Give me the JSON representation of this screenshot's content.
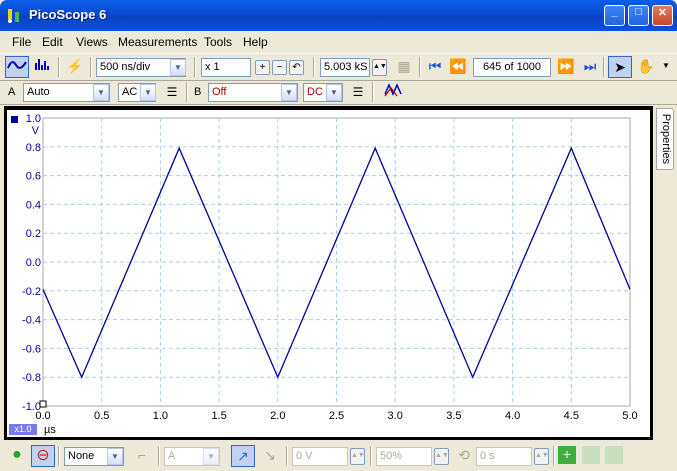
{
  "window": {
    "title": "PicoScope 6"
  },
  "menu": [
    "File",
    "Edit",
    "Views",
    "Measurements",
    "Tools",
    "Help"
  ],
  "toolbar": {
    "timebase": "500 ns/div",
    "zoom": "x 1",
    "samples": "5.003 kS",
    "buffer": "645 of 1000"
  },
  "channels": {
    "a_label": "A",
    "a_range": "Auto",
    "a_coupling": "AC",
    "b_label": "B",
    "b_range": "Off",
    "b_coupling": "DC"
  },
  "properties_tab": "Properties",
  "scale_badge": "x1.0",
  "trigger": {
    "mode": "None",
    "source": "A",
    "level": "0 V",
    "pretrigger": "50%",
    "delay": "0 s"
  },
  "chart_data": {
    "type": "line",
    "xlabel": "µs",
    "ylabel": "V",
    "xlim": [
      0,
      5.0
    ],
    "ylim": [
      -1.0,
      1.0
    ],
    "x_ticks": [
      "0.0",
      "0.5",
      "1.0",
      "1.5",
      "2.0",
      "2.5",
      "3.0",
      "3.5",
      "4.0",
      "4.5",
      "5.0"
    ],
    "y_ticks": [
      "1.0",
      "0.8",
      "0.6",
      "0.4",
      "0.2",
      "0.0",
      "-0.2",
      "-0.4",
      "-0.6",
      "-0.8",
      "-1.0"
    ],
    "grid": true,
    "series": [
      {
        "color": "#0000A0",
        "x": [
          0.0,
          0.33,
          1.16,
          2.0,
          2.83,
          3.66,
          4.5,
          5.0
        ],
        "y": [
          -0.19,
          -0.8,
          0.79,
          -0.8,
          0.79,
          -0.8,
          0.79,
          -0.19
        ]
      }
    ]
  },
  "colors": {
    "trace": "#0000A0",
    "grid": "#A8D0E8"
  }
}
